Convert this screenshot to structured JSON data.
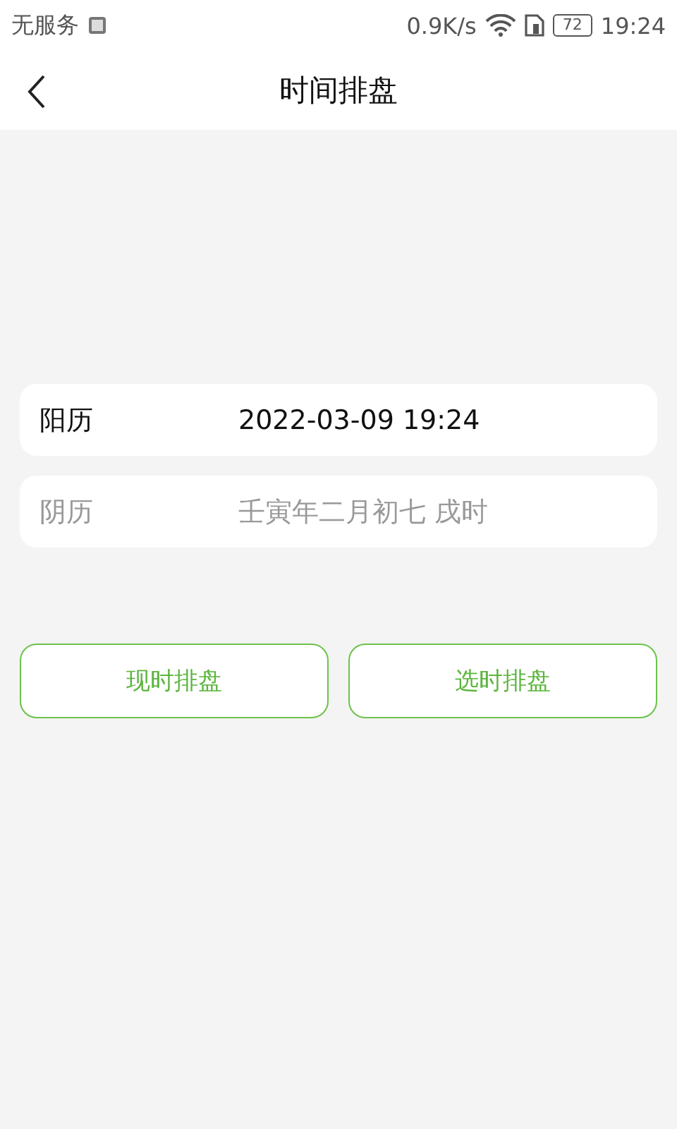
{
  "status_bar": {
    "carrier": "无服务",
    "speed": "0.9K/s",
    "battery": "72",
    "time": "19:24"
  },
  "header": {
    "title": "时间排盘"
  },
  "rows": [
    {
      "label": "阳历",
      "value": "2022-03-09 19:24",
      "disabled": false
    },
    {
      "label": "阴历",
      "value": "壬寅年二月初七 戌时",
      "disabled": true
    }
  ],
  "buttons": [
    "现时排盘",
    "选时排盘"
  ]
}
